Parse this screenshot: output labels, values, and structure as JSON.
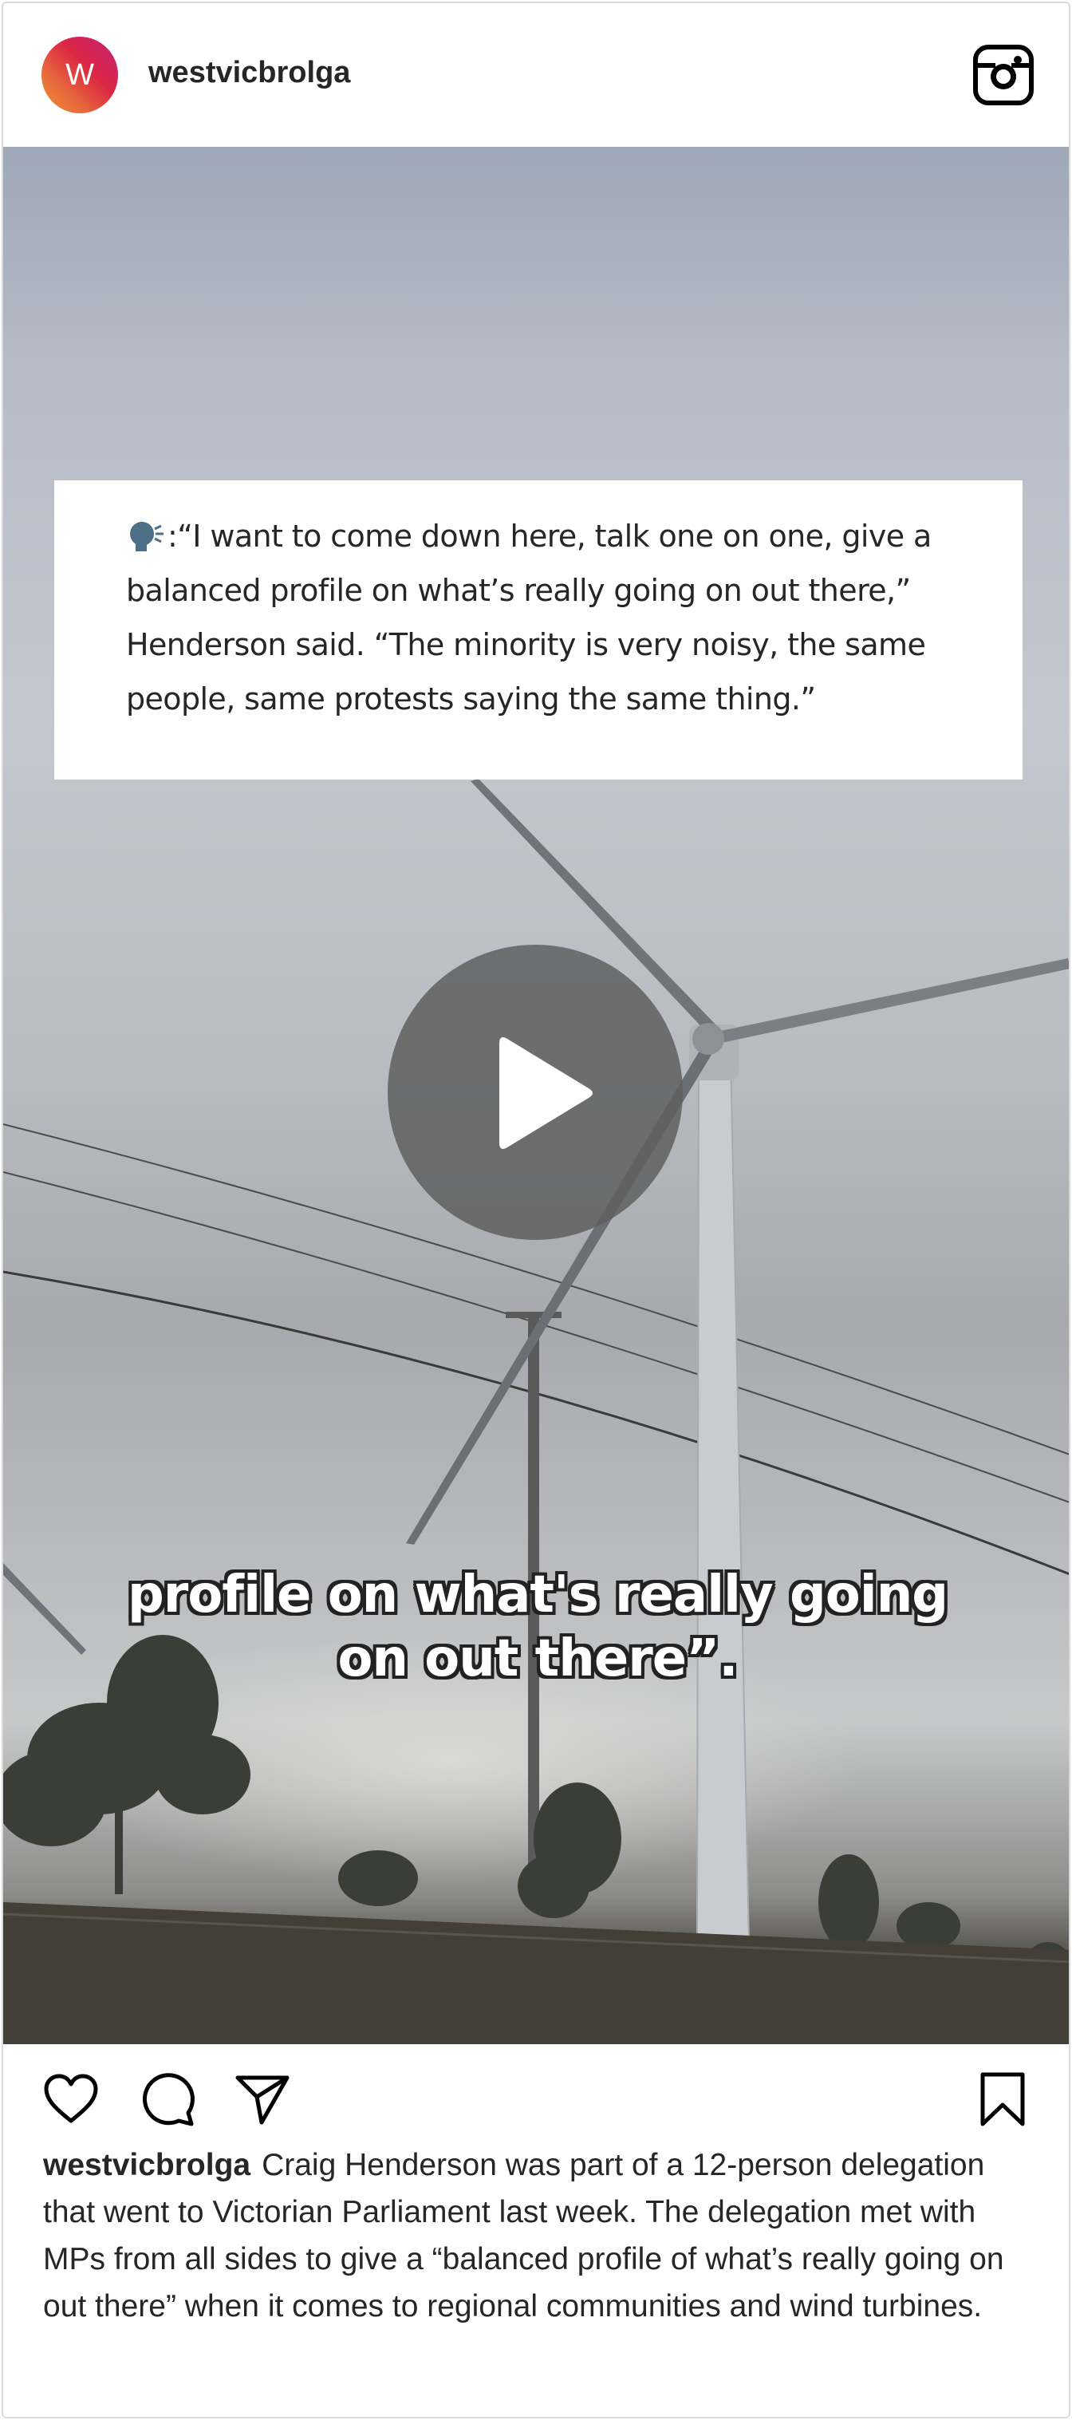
{
  "header": {
    "avatar_letter": "W",
    "username": "westvicbrolga"
  },
  "media": {
    "quote_prefix": ":",
    "quote_text": "“I want to come down here, talk one on one, give a balanced profile on what’s really going on out there,” Henderson said. “The minority is very noisy, the same people, same protests saying the same thing.”",
    "subtitle_line1": "profile on what's really going",
    "subtitle_line2": "on out there”."
  },
  "actions": {
    "icons": [
      "heart-icon",
      "comment-icon",
      "share-icon",
      "bookmark-icon"
    ]
  },
  "caption": {
    "username": "westvicbrolga",
    "text": "Craig Henderson was part of a 12-person delegation that went to Victorian Parliament last week. The delegation met with MPs from all sides to give a “balanced profile of what’s really going on out there” when it comes to regional communities and wind turbines."
  },
  "colors": {
    "avatar_gradient_start": "#f09433",
    "avatar_gradient_end": "#bc1888",
    "text": "#262626",
    "border": "#dbdbdb"
  }
}
